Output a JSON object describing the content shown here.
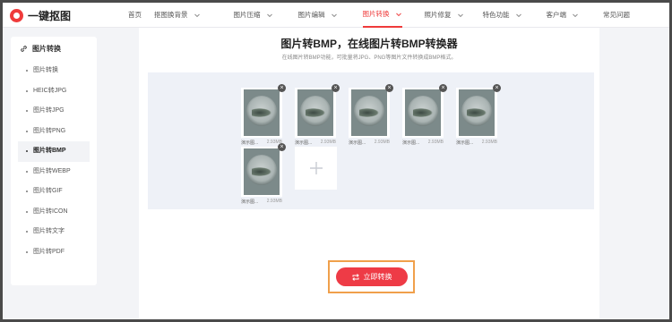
{
  "brand": {
    "name": "一键抠图",
    "accent": "#ef3b3b"
  },
  "nav": {
    "items": [
      {
        "label": "首页",
        "has_dropdown": false,
        "active": false
      },
      {
        "label": "抠图换背景",
        "has_dropdown": true,
        "active": false
      },
      {
        "label": "图片压缩",
        "has_dropdown": true,
        "active": false
      },
      {
        "label": "图片编辑",
        "has_dropdown": true,
        "active": false
      },
      {
        "label": "图片转换",
        "has_dropdown": true,
        "active": true
      },
      {
        "label": "照片修复",
        "has_dropdown": true,
        "active": false
      },
      {
        "label": "特色功能",
        "has_dropdown": true,
        "active": false
      },
      {
        "label": "客户端",
        "has_dropdown": true,
        "active": false
      },
      {
        "label": "常见问题",
        "has_dropdown": false,
        "active": false
      }
    ]
  },
  "sidebar": {
    "heading": "图片转换",
    "heading_icon": "link-icon",
    "items": [
      {
        "label": "图片转换",
        "active": false
      },
      {
        "label": "HEIC转JPG",
        "active": false
      },
      {
        "label": "图片转JPG",
        "active": false
      },
      {
        "label": "图片转PNG",
        "active": false
      },
      {
        "label": "图片转BMP",
        "active": true
      },
      {
        "label": "图片转WEBP",
        "active": false
      },
      {
        "label": "图片转GIF",
        "active": false
      },
      {
        "label": "图片转ICON",
        "active": false
      },
      {
        "label": "图片转文字",
        "active": false
      },
      {
        "label": "图片转PDF",
        "active": false
      }
    ]
  },
  "main": {
    "title": "图片转BMP，在线图片转BMP转换器",
    "subtitle": "在线图片转BMP功能，可批量将JPG、PNG等图片文件转换成BMP格式。",
    "files": [
      {
        "name": "演示图...",
        "size": "2.93MB"
      },
      {
        "name": "演示图...",
        "size": "2.93MB"
      },
      {
        "name": "演示图...",
        "size": "2.93MB"
      },
      {
        "name": "演示图...",
        "size": "2.93MB"
      },
      {
        "name": "演示图...",
        "size": "2.93MB"
      },
      {
        "name": "演示图...",
        "size": "2.93MB"
      }
    ],
    "add_icon": "plus-icon",
    "convert_button": {
      "label": "立即转换",
      "icon": "convert-icon",
      "color": "#ee3b46",
      "highlight_border": "#f0a04b"
    }
  }
}
